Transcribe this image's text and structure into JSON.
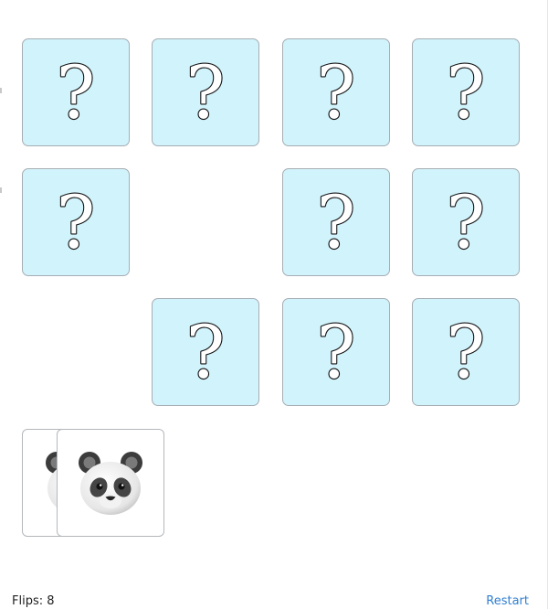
{
  "board": {
    "cards": [
      {
        "state": "hidden",
        "face": "?"
      },
      {
        "state": "hidden",
        "face": "?"
      },
      {
        "state": "hidden",
        "face": "?"
      },
      {
        "state": "hidden",
        "face": "?"
      },
      {
        "state": "hidden",
        "face": "?"
      },
      {
        "state": "removed"
      },
      {
        "state": "hidden",
        "face": "?"
      },
      {
        "state": "hidden",
        "face": "?"
      },
      {
        "state": "removed"
      },
      {
        "state": "hidden",
        "face": "?"
      },
      {
        "state": "hidden",
        "face": "?"
      },
      {
        "state": "hidden",
        "face": "?"
      }
    ],
    "matched_pile": {
      "icon": "panda-face-icon",
      "count": 2
    }
  },
  "footer": {
    "flips_label": "Flips:",
    "flips_count": "8",
    "restart_label": "Restart"
  },
  "colors": {
    "card_back": "#d1f3fc",
    "card_border": "#a6adb3",
    "link": "#2f7fd0"
  }
}
